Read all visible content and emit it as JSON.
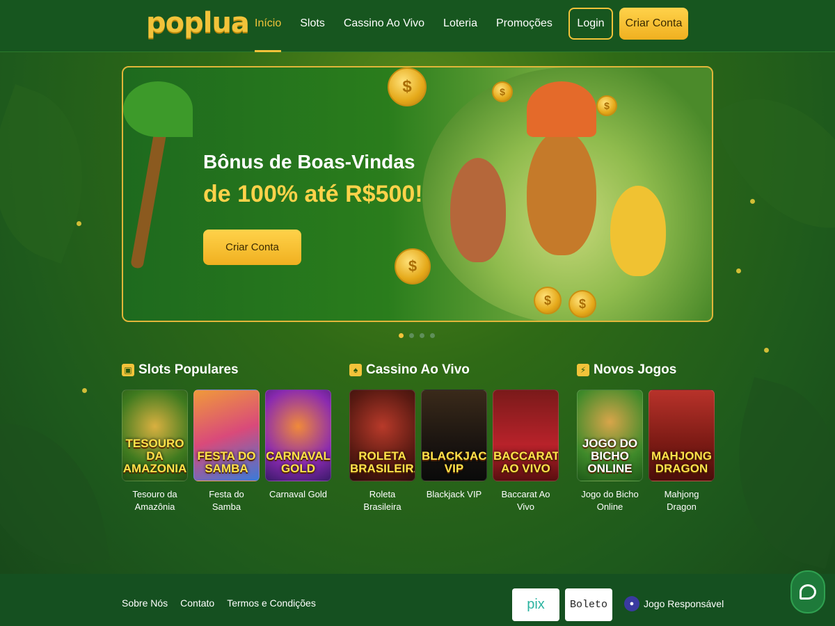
{
  "header": {
    "logo": "poplua",
    "nav": [
      "Início",
      "Slots",
      "Cassino Ao Vivo",
      "Loteria",
      "Promoções"
    ],
    "active_nav": "Início",
    "login_label": "Login",
    "signup_label": "Criar Conta"
  },
  "banner": {
    "title": "Bônus de Boas-Vindas",
    "subtitle": "de 100% até R$500!",
    "cta_label": "Criar Conta",
    "slides": 4,
    "active_slide": 1
  },
  "sections": {
    "slots": {
      "title": "Slots Populares",
      "games": [
        {
          "label": "Tesouro da Amazônia",
          "thumb_text": "TESOURO DA AMAZONIA"
        },
        {
          "label": "Festa do Samba",
          "thumb_text": "FESTA DO SAMBA"
        },
        {
          "label": "Carnaval Gold",
          "thumb_text": "CARNAVAL GOLD"
        }
      ]
    },
    "live": {
      "title": "Cassino Ao Vivo",
      "games": [
        {
          "label": "Roleta Brasileira",
          "thumb_text": "ROLETA BRASILEIRA"
        },
        {
          "label": "Blackjack VIP",
          "thumb_text": "BLACKJACK VIP"
        },
        {
          "label": "Baccarat Ao Vivo",
          "thumb_text": "BACCARAT AO VIVO"
        }
      ]
    },
    "new": {
      "title": "Novos Jogos",
      "games": [
        {
          "label": "Jogo do Bicho Online",
          "thumb_text": "JOGO DO BICHO ONLINE"
        },
        {
          "label": "Mahjong Dragon",
          "thumb_text": "MAHJONG DRAGON"
        }
      ]
    }
  },
  "footer": {
    "links": [
      "Sobre Nós",
      "Contato",
      "Termos e Condições"
    ],
    "payments": [
      "pix",
      "Boleto"
    ],
    "responsible_label": "Jogo Responsável"
  },
  "colors": {
    "accent": "#f2c33a",
    "header_bg": "#17561f",
    "footer_bg": "#155020"
  }
}
